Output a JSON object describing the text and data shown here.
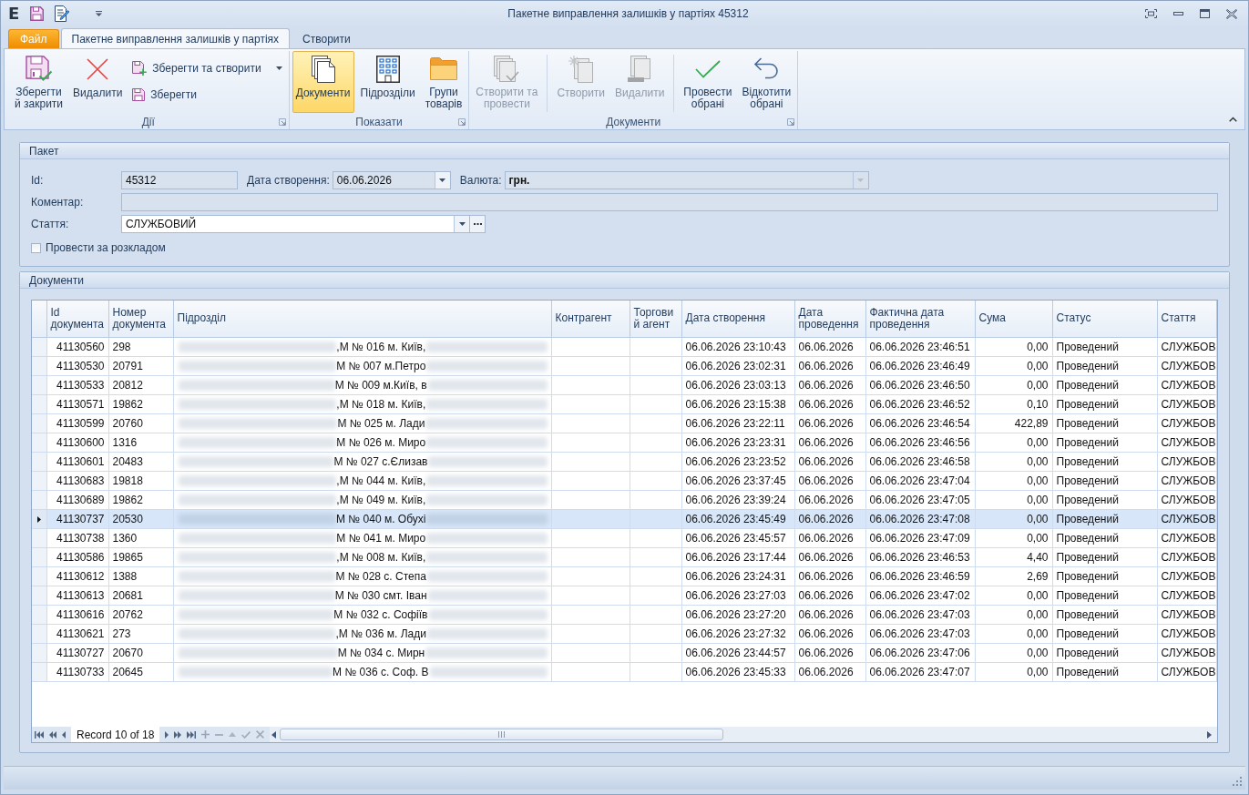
{
  "window": {
    "app_logo": "E",
    "title": "Пакетне виправлення залишків у партіях 45312"
  },
  "ribbon": {
    "tabs": [
      {
        "label": "Файл",
        "kind": "file",
        "selected": false
      },
      {
        "label": "Пакетне виправлення залишків у партіях",
        "kind": "tab",
        "selected": true
      },
      {
        "label": "Створити",
        "kind": "tab",
        "selected": false
      }
    ],
    "groups": [
      {
        "label": "Дії",
        "items": [
          {
            "kind": "large",
            "label": "Зберегти\nй закрити",
            "selected": false,
            "disabled": false
          },
          {
            "kind": "large",
            "label": "Видалити",
            "selected": false,
            "disabled": false
          },
          {
            "kind": "small",
            "label": "Зберегти та створити",
            "dropdown": true,
            "selected": false,
            "disabled": false
          },
          {
            "kind": "small",
            "label": "Зберегти",
            "selected": false,
            "disabled": false
          }
        ]
      },
      {
        "label": "Показати",
        "items": [
          {
            "kind": "large",
            "label": "Документи",
            "selected": true,
            "disabled": false
          },
          {
            "kind": "large",
            "label": "Підрозділи",
            "selected": false,
            "disabled": false
          },
          {
            "kind": "large",
            "label": "Групи\nтоварів",
            "selected": false,
            "disabled": false
          }
        ]
      },
      {
        "label": "Документи",
        "items": [
          {
            "kind": "large",
            "label": "Створити та\nпровести",
            "selected": false,
            "disabled": true
          },
          {
            "kind": "separator"
          },
          {
            "kind": "large",
            "label": "Створити",
            "selected": false,
            "disabled": true
          },
          {
            "kind": "large",
            "label": "Видалити",
            "selected": false,
            "disabled": true
          },
          {
            "kind": "separator"
          },
          {
            "kind": "large",
            "label": "Провести\nобрані",
            "selected": false,
            "disabled": false
          },
          {
            "kind": "large",
            "label": "Відкотити\nобрані",
            "selected": false,
            "disabled": false
          }
        ]
      }
    ]
  },
  "package": {
    "title": "Пакет",
    "id_field": {
      "label": "Id:",
      "value": "45312",
      "readonly": true
    },
    "created_field": {
      "label": "Дата створення:",
      "value": "06.06.2026",
      "readonly": true,
      "disabled": false
    },
    "currency_field": {
      "label": "Валюта:",
      "value": "грн.",
      "readonly": true,
      "disabled": true
    },
    "comment_field": {
      "label": "Коментар:",
      "readonly": true
    },
    "article_field": {
      "label": "Стаття:",
      "value": "СЛУЖБОВИЙ",
      "readonly": false,
      "disabled": false
    },
    "schedule_checkbox": {
      "label": "Провести за розкладом",
      "checked": false
    }
  },
  "documents": {
    "title": "Документи",
    "columns": [
      "Id\nдокумента",
      "Номер\nдокумента",
      "Підрозділ",
      "Контрагент",
      "Торгови\nй агент",
      "Дата створення",
      "Дата\nпроведення",
      "Фактична дата\nпроведення",
      "Сума",
      "Статус",
      "Стаття"
    ],
    "rows": [
      {
        "id": "41130560",
        "number": "298",
        "unit": ",М № 016 м. Київ,",
        "created": "06.06.2026 23:10:43",
        "posted": "06.06.2026",
        "actual": "06.06.2026 23:46:51",
        "sum": "0,00",
        "status": "Проведений",
        "article": "СЛУЖБОВ",
        "selected": false
      },
      {
        "id": "41130530",
        "number": "20791",
        "unit": "М № 007 м.Петро",
        "created": "06.06.2026 23:02:31",
        "posted": "06.06.2026",
        "actual": "06.06.2026 23:46:49",
        "sum": "0,00",
        "status": "Проведений",
        "article": "СЛУЖБОВ",
        "selected": false
      },
      {
        "id": "41130533",
        "number": "20812",
        "unit": "М № 009 м.Київ, в",
        "created": "06.06.2026 23:03:13",
        "posted": "06.06.2026",
        "actual": "06.06.2026 23:46:50",
        "sum": "0,00",
        "status": "Проведений",
        "article": "СЛУЖБОВ",
        "selected": false
      },
      {
        "id": "41130571",
        "number": "19862",
        "unit": ",М № 018 м. Київ,",
        "created": "06.06.2026 23:15:38",
        "posted": "06.06.2026",
        "actual": "06.06.2026 23:46:52",
        "sum": "0,10",
        "status": "Проведений",
        "article": "СЛУЖБОВ",
        "selected": false
      },
      {
        "id": "41130599",
        "number": "20760",
        "unit": "М № 025 м. Лади",
        "created": "06.06.2026 23:22:11",
        "posted": "06.06.2026",
        "actual": "06.06.2026 23:46:54",
        "sum": "422,89",
        "status": "Проведений",
        "article": "СЛУЖБОВ",
        "selected": false
      },
      {
        "id": "41130600",
        "number": "1316",
        "unit": "М № 026 м. Миро",
        "created": "06.06.2026 23:23:31",
        "posted": "06.06.2026",
        "actual": "06.06.2026 23:46:56",
        "sum": "0,00",
        "status": "Проведений",
        "article": "СЛУЖБОВ",
        "selected": false
      },
      {
        "id": "41130601",
        "number": "20483",
        "unit": "М № 027 с.Єлизав",
        "created": "06.06.2026 23:23:52",
        "posted": "06.06.2026",
        "actual": "06.06.2026 23:46:58",
        "sum": "0,00",
        "status": "Проведений",
        "article": "СЛУЖБОВ",
        "selected": false
      },
      {
        "id": "41130683",
        "number": "19818",
        "unit": ",М № 044 м. Київ,",
        "created": "06.06.2026 23:37:45",
        "posted": "06.06.2026",
        "actual": "06.06.2026 23:47:04",
        "sum": "0,00",
        "status": "Проведений",
        "article": "СЛУЖБОВ",
        "selected": false
      },
      {
        "id": "41130689",
        "number": "19862",
        "unit": ",М № 049 м. Київ,",
        "created": "06.06.2026 23:39:24",
        "posted": "06.06.2026",
        "actual": "06.06.2026 23:47:05",
        "sum": "0,00",
        "status": "Проведений",
        "article": "СЛУЖБОВ",
        "selected": false
      },
      {
        "id": "41130737",
        "number": "20530",
        "unit": "М № 040 м. Обухі",
        "created": "06.06.2026 23:45:49",
        "posted": "06.06.2026",
        "actual": "06.06.2026 23:47:08",
        "sum": "0,00",
        "status": "Проведений",
        "article": "СЛУЖБОВ",
        "selected": true
      },
      {
        "id": "41130738",
        "number": "1360",
        "unit": "М № 041 м. Миро",
        "created": "06.06.2026 23:45:57",
        "posted": "06.06.2026",
        "actual": "06.06.2026 23:47:09",
        "sum": "0,00",
        "status": "Проведений",
        "article": "СЛУЖБОВ",
        "selected": false
      },
      {
        "id": "41130586",
        "number": "19865",
        "unit": ",М № 008 м. Київ,",
        "created": "06.06.2026 23:17:44",
        "posted": "06.06.2026",
        "actual": "06.06.2026 23:46:53",
        "sum": "4,40",
        "status": "Проведений",
        "article": "СЛУЖБОВ",
        "selected": false
      },
      {
        "id": "41130612",
        "number": "1388",
        "unit": "М № 028 с. Степа",
        "created": "06.06.2026 23:24:31",
        "posted": "06.06.2026",
        "actual": "06.06.2026 23:46:59",
        "sum": "2,69",
        "status": "Проведений",
        "article": "СЛУЖБОВ",
        "selected": false
      },
      {
        "id": "41130613",
        "number": "20681",
        "unit": "М № 030 смт. Іван",
        "created": "06.06.2026 23:27:03",
        "posted": "06.06.2026",
        "actual": "06.06.2026 23:47:02",
        "sum": "0,00",
        "status": "Проведений",
        "article": "СЛУЖБОВ",
        "selected": false
      },
      {
        "id": "41130616",
        "number": "20762",
        "unit": "М № 032 с. Софіїв",
        "created": "06.06.2026 23:27:20",
        "posted": "06.06.2026",
        "actual": "06.06.2026 23:47:03",
        "sum": "0,00",
        "status": "Проведений",
        "article": "СЛУЖБОВ",
        "selected": false
      },
      {
        "id": "41130621",
        "number": "273",
        "unit": ",М № 036 м. Лади",
        "created": "06.06.2026 23:27:32",
        "posted": "06.06.2026",
        "actual": "06.06.2026 23:47:03",
        "sum": "0,00",
        "status": "Проведений",
        "article": "СЛУЖБОВ",
        "selected": false
      },
      {
        "id": "41130727",
        "number": "20670",
        "unit": "М № 034 с. Мирн",
        "created": "06.06.2026 23:44:57",
        "posted": "06.06.2026",
        "actual": "06.06.2026 23:47:06",
        "sum": "0,00",
        "status": "Проведений",
        "article": "СЛУЖБОВ",
        "selected": false
      },
      {
        "id": "41130733",
        "number": "20645",
        "unit": "М № 036 с. Соф. В",
        "created": "06.06.2026 23:45:33",
        "posted": "06.06.2026",
        "actual": "06.06.2026 23:47:07",
        "sum": "0,00",
        "status": "Проведений",
        "article": "СЛУЖБОВ",
        "selected": false
      }
    ],
    "navigator": {
      "record": "Record 10 of 18"
    }
  }
}
